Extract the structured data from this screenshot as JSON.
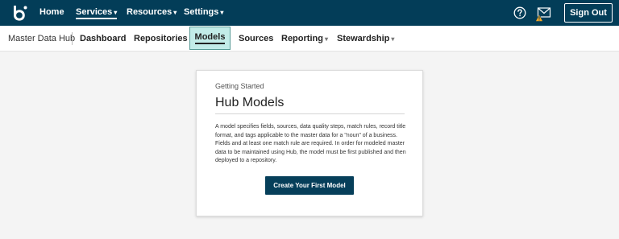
{
  "colors": {
    "topbar_bg": "#033d58",
    "active_tab_bg": "#c2ece8",
    "primary_button": "#063f5a",
    "warning_badge": "#f5a623"
  },
  "topbar": {
    "logo_icon": "boomi-b-logo",
    "nav": [
      {
        "label": "Home",
        "caret": ""
      },
      {
        "label": "Services",
        "caret": "▾"
      },
      {
        "label": "Resources",
        "caret": "▾"
      },
      {
        "label": "Settings",
        "caret": "▾"
      }
    ],
    "help_icon": "question-circle-icon",
    "mail_icon": "envelope-warning-icon",
    "sign_out_label": "Sign Out"
  },
  "subnav": {
    "app_name": "Master Data Hub",
    "items": [
      {
        "label": "Dashboard",
        "caret": ""
      },
      {
        "label": "Repositories",
        "caret": ""
      },
      {
        "label": "Models",
        "caret": ""
      },
      {
        "label": "Sources",
        "caret": ""
      },
      {
        "label": "Reporting",
        "caret": "▾"
      },
      {
        "label": "Stewardship",
        "caret": "▾"
      }
    ],
    "active_item": "Models"
  },
  "card": {
    "eyebrow": "Getting Started",
    "title": "Hub Models",
    "description": "A model specifies fields, sources, data quality steps, match rules, record title format, and tags applicable to the master data for a \"noun\" of a business. Fields and at least one match rule are required. In order for modeled master data to be maintained using Hub, the model must be first published and then deployed to a repository.",
    "button_label": "Create Your First Model"
  }
}
